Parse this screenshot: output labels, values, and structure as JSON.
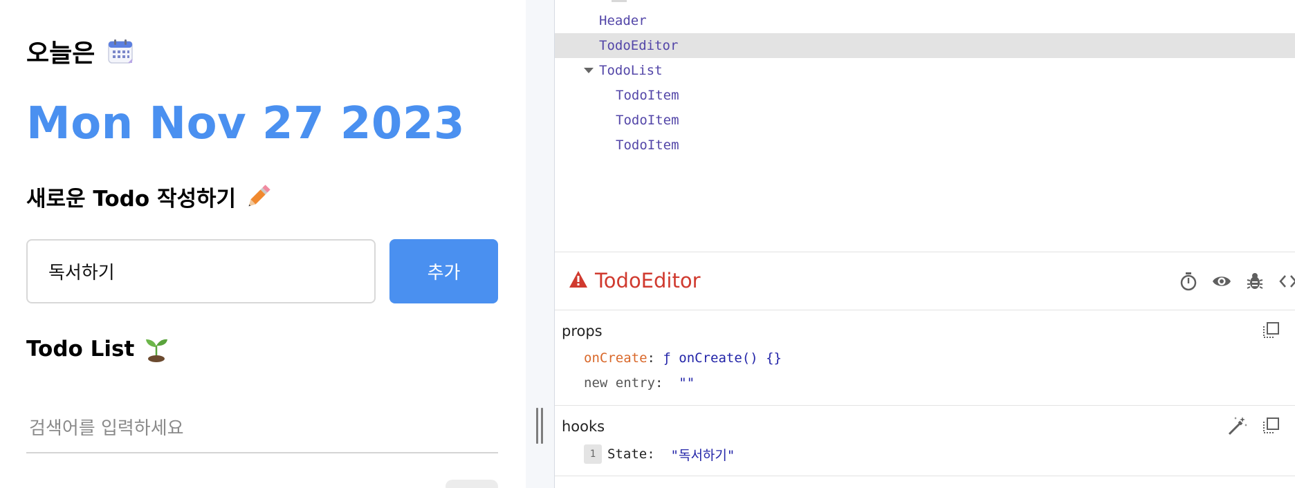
{
  "app": {
    "today_heading": "오늘은",
    "date": "Mon Nov 27 2023",
    "new_todo_heading": "새로운 Todo 작성하기",
    "input_value": "독서하기",
    "add_button": "추가",
    "list_heading": "Todo List",
    "search_placeholder": "검색어를 입력하세요"
  },
  "devtools": {
    "tree": [
      {
        "label": "Header",
        "depth": 1,
        "selected": false
      },
      {
        "label": "TodoEditor",
        "depth": 1,
        "selected": true
      },
      {
        "label": "TodoList",
        "depth": 1,
        "selected": false,
        "expanded": true
      },
      {
        "label": "TodoItem",
        "depth": 2,
        "selected": false
      },
      {
        "label": "TodoItem",
        "depth": 2,
        "selected": false
      },
      {
        "label": "TodoItem",
        "depth": 2,
        "selected": false
      }
    ],
    "selected_component": "TodoEditor",
    "props": {
      "title": "props",
      "items": [
        {
          "key": "onCreate",
          "value": "ƒ onCreate() {}"
        },
        {
          "key": "new entry",
          "value": "\"\""
        }
      ]
    },
    "hooks": {
      "title": "hooks",
      "items": [
        {
          "index": "1",
          "key": "State",
          "value": "\"독서하기\""
        }
      ]
    },
    "colors": {
      "accent_blue": "#4a90f0",
      "component_name": "#d03a2f",
      "tree_text": "#5346a8",
      "prop_key": "#d9682a",
      "value_blue": "#2224a8"
    },
    "icons": [
      "warning-icon",
      "timer-icon",
      "eye-icon",
      "bug-icon",
      "code-icon",
      "copy-icon",
      "wand-icon"
    ]
  }
}
